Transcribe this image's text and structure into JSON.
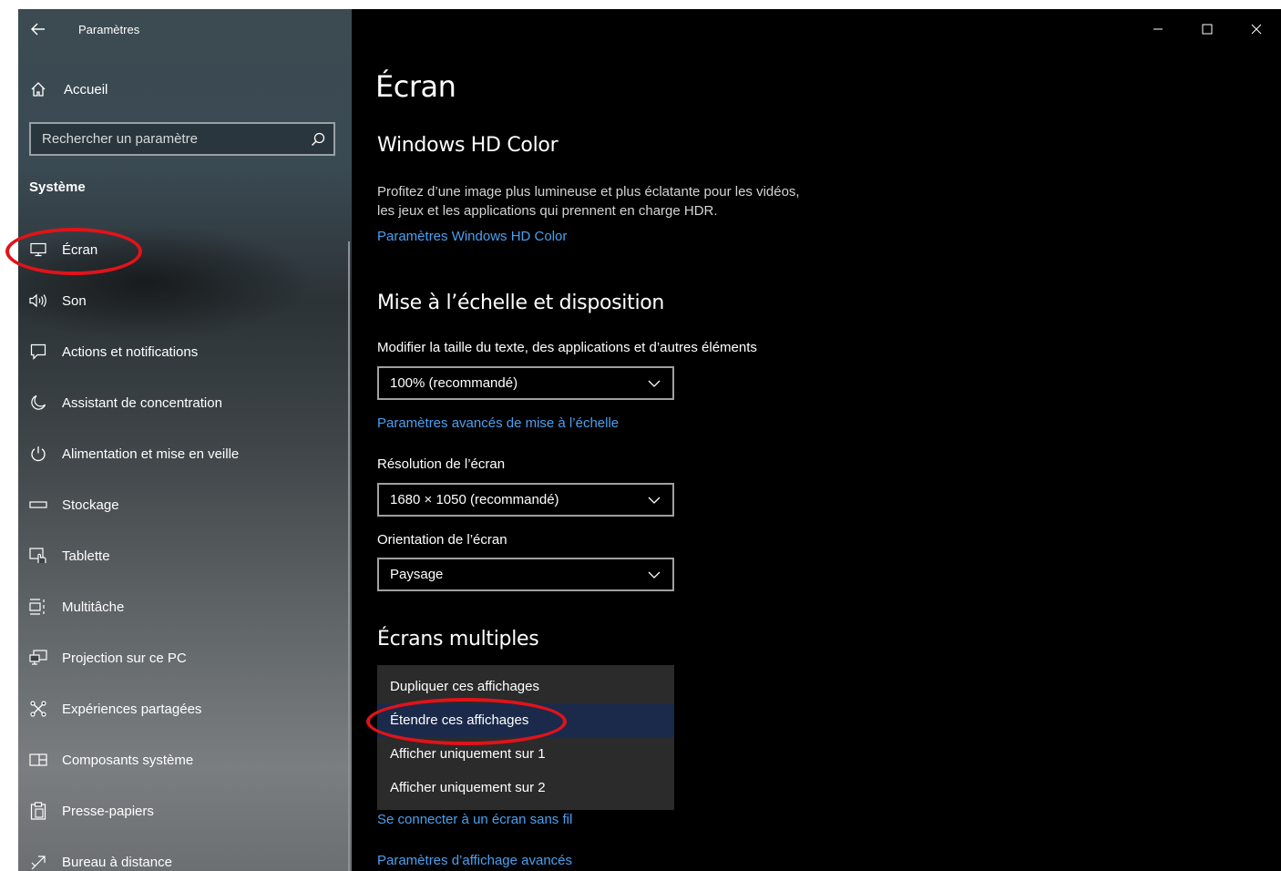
{
  "window": {
    "app_title": "Paramètres",
    "back_icon": "arrow-left-icon",
    "controls": [
      "minimize-icon",
      "maximize-icon",
      "close-icon"
    ]
  },
  "sidebar": {
    "home_label": "Accueil",
    "search_placeholder": "Rechercher un paramètre",
    "section_label": "Système",
    "items": [
      {
        "label": "Écran",
        "icon": "monitor-icon"
      },
      {
        "label": "Son",
        "icon": "speaker-icon"
      },
      {
        "label": "Actions et notifications",
        "icon": "notification-icon"
      },
      {
        "label": "Assistant de concentration",
        "icon": "moon-icon"
      },
      {
        "label": "Alimentation et mise en veille",
        "icon": "power-icon"
      },
      {
        "label": "Stockage",
        "icon": "storage-icon"
      },
      {
        "label": "Tablette",
        "icon": "tablet-icon"
      },
      {
        "label": "Multitâche",
        "icon": "multitask-icon"
      },
      {
        "label": "Projection sur ce PC",
        "icon": "projection-icon"
      },
      {
        "label": "Expériences partagées",
        "icon": "shared-experiences-icon"
      },
      {
        "label": "Composants système",
        "icon": "system-components-icon"
      },
      {
        "label": "Presse-papiers",
        "icon": "clipboard-icon"
      },
      {
        "label": "Bureau à distance",
        "icon": "remote-desktop-icon"
      }
    ]
  },
  "main": {
    "page_title": "Écran",
    "hdr": {
      "heading": "Windows HD Color",
      "description_line1": "Profitez d’une image plus lumineuse et plus éclatante pour les vidéos,",
      "description_line2": "les jeux et les applications qui prennent en charge HDR.",
      "link": "Paramètres Windows HD Color"
    },
    "scale": {
      "heading": "Mise à l’échelle et disposition",
      "size_label": "Modifier la taille du texte, des applications et d’autres éléments",
      "size_value": "100% (recommandé)",
      "advanced_link": "Paramètres avancés de mise à l’échelle",
      "resolution_label": "Résolution de l’écran",
      "resolution_value": "1680 × 1050 (recommandé)",
      "orientation_label": "Orientation de l’écran",
      "orientation_value": "Paysage"
    },
    "multiple": {
      "heading": "Écrans multiples",
      "options": [
        "Dupliquer ces affichages",
        "Étendre ces affichages",
        "Afficher uniquement sur 1",
        "Afficher uniquement sur 2"
      ],
      "selected_option": "Étendre ces affichages",
      "wireless_link": "Se connecter à un écran sans fil",
      "advanced_display_link": "Paramètres d’affichage avancés"
    }
  },
  "colors": {
    "link": "#4aa0f0",
    "annotation": "#e0131a",
    "selected_row": "#1b2a4a"
  }
}
